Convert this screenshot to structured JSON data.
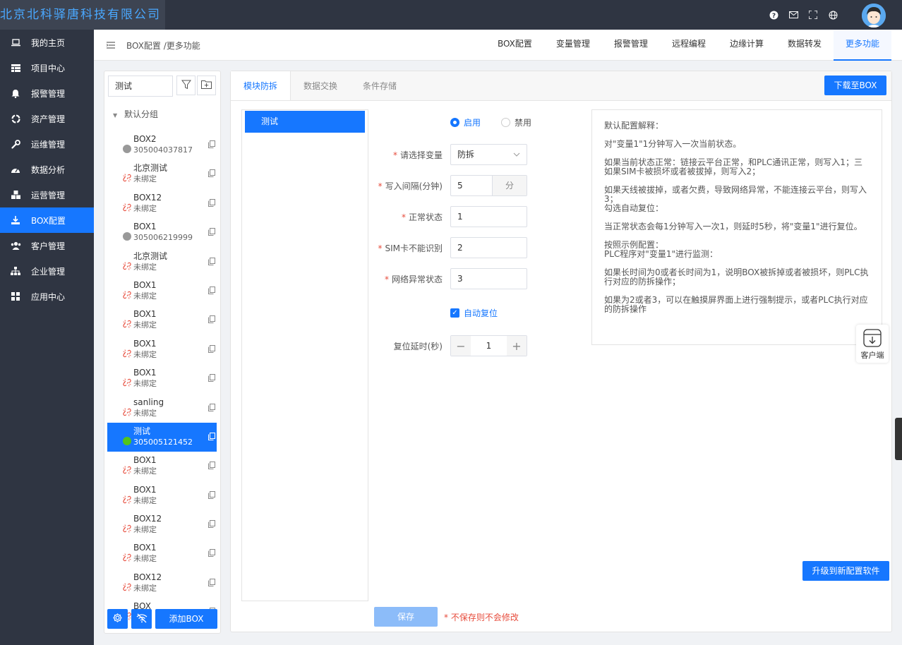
{
  "brand": {
    "company": "北京北科驿唐科技有限公司"
  },
  "top_icons": [
    "help-icon",
    "mail-icon",
    "fullscreen-icon",
    "globe-icon"
  ],
  "sidebar": {
    "items": [
      {
        "label": "我的主页",
        "icon": "laptop-icon",
        "active": false
      },
      {
        "label": "项目中心",
        "icon": "table-icon",
        "active": false
      },
      {
        "label": "报警管理",
        "icon": "bell-icon",
        "active": false
      },
      {
        "label": "资产管理",
        "icon": "recycle-icon",
        "active": false
      },
      {
        "label": "运维管理",
        "icon": "wrench-icon",
        "active": false
      },
      {
        "label": "数据分析",
        "icon": "dashboard-icon",
        "active": false
      },
      {
        "label": "运营管理",
        "icon": "cubes-icon",
        "active": false
      },
      {
        "label": "BOX配置",
        "icon": "download-icon",
        "active": true
      },
      {
        "label": "客户管理",
        "icon": "users-icon",
        "active": false
      },
      {
        "label": "企业管理",
        "icon": "sitemap-icon",
        "active": false
      },
      {
        "label": "应用中心",
        "icon": "grid-icon",
        "active": false
      }
    ]
  },
  "header": {
    "breadcrumb": "BOX配置 /更多功能",
    "tabs": [
      "BOX配置",
      "变量管理",
      "报警管理",
      "远程编程",
      "边缘计算",
      "数据转发",
      "更多功能"
    ],
    "active_tab": "更多功能"
  },
  "left_panel": {
    "search_value": "测试",
    "group": "默认分组",
    "items": [
      {
        "name": "BOX2",
        "sub": "305004037817",
        "status": "offline"
      },
      {
        "name": "北京测试",
        "sub": "未绑定",
        "status": "unbound"
      },
      {
        "name": "BOX12",
        "sub": "未绑定",
        "status": "unbound"
      },
      {
        "name": "BOX1",
        "sub": "305006219999",
        "status": "offline"
      },
      {
        "name": "北京测试",
        "sub": "未绑定",
        "status": "unbound"
      },
      {
        "name": "BOX1",
        "sub": "未绑定",
        "status": "unbound"
      },
      {
        "name": "BOX1",
        "sub": "未绑定",
        "status": "unbound"
      },
      {
        "name": "BOX1",
        "sub": "未绑定",
        "status": "unbound"
      },
      {
        "name": "BOX1",
        "sub": "未绑定",
        "status": "unbound"
      },
      {
        "name": "sanling",
        "sub": "未绑定",
        "status": "unbound"
      },
      {
        "name": "测试",
        "sub": "305005121452",
        "status": "online",
        "selected": true
      },
      {
        "name": "BOX1",
        "sub": "未绑定",
        "status": "unbound"
      },
      {
        "name": "BOX1",
        "sub": "未绑定",
        "status": "unbound"
      },
      {
        "name": "BOX12",
        "sub": "未绑定",
        "status": "unbound"
      },
      {
        "name": "BOX1",
        "sub": "未绑定",
        "status": "unbound"
      },
      {
        "name": "BOX12",
        "sub": "未绑定",
        "status": "unbound"
      },
      {
        "name": "BOX",
        "sub": "",
        "status": "unbound"
      }
    ],
    "add_button": "添加BOX"
  },
  "main": {
    "subtabs": [
      "模块防拆",
      "数据交换",
      "条件存储"
    ],
    "active_subtab": "模块防拆",
    "download_button": "下载至BOX",
    "module_item": "测试",
    "enable_label": "启用",
    "disable_label": "禁用",
    "fields": {
      "variable_label": "请选择变量",
      "variable_value": "防拆",
      "interval_label": "写入间隔(分钟)",
      "interval_value": "5",
      "interval_unit": "分",
      "normal_label": "正常状态",
      "normal_value": "1",
      "sim_label": "SIM卡不能识别",
      "sim_value": "2",
      "network_label": "网络异常状态",
      "network_value": "3",
      "auto_reset_label": "自动复位",
      "reset_delay_label": "复位延时(秒)",
      "reset_delay_value": "1"
    },
    "explanation": [
      "默认配置解释：",
      "对\"变量1\"1分钟写入一次当前状态。",
      "如果当前状态正常：链接云平台正常，和PLC通讯正常，则写入1；三如果SIM卡被损坏或者被拔掉，则写入2；",
      "如果天线被拔掉，或者欠费，导致网络异常，不能连接云平台，则写入3；\n勾选自动复位：",
      "当正常状态会每1分钟写入一次1，则延时5秒，将\"变量1\"进行复位。",
      "按照示例配置：\nPLC程序对\"变量1\"进行监测：",
      "如果长时间为0或者长时间为1，说明BOX被拆掉或者被损坏，则PLC执行对应的防拆操作；",
      "如果为2或者3，可以在触摸屏界面上进行强制提示，或者PLC执行对应的防拆操作"
    ],
    "upgrade_button": "升级到新配置软件",
    "save_button": "保存",
    "save_note": "* 不保存则不会修改"
  },
  "client_widget": {
    "label": "客户端"
  },
  "colors": {
    "primary": "#1677ff",
    "sidebar": "#2f3542",
    "danger": "#e74c3c",
    "online": "#52c41a"
  }
}
